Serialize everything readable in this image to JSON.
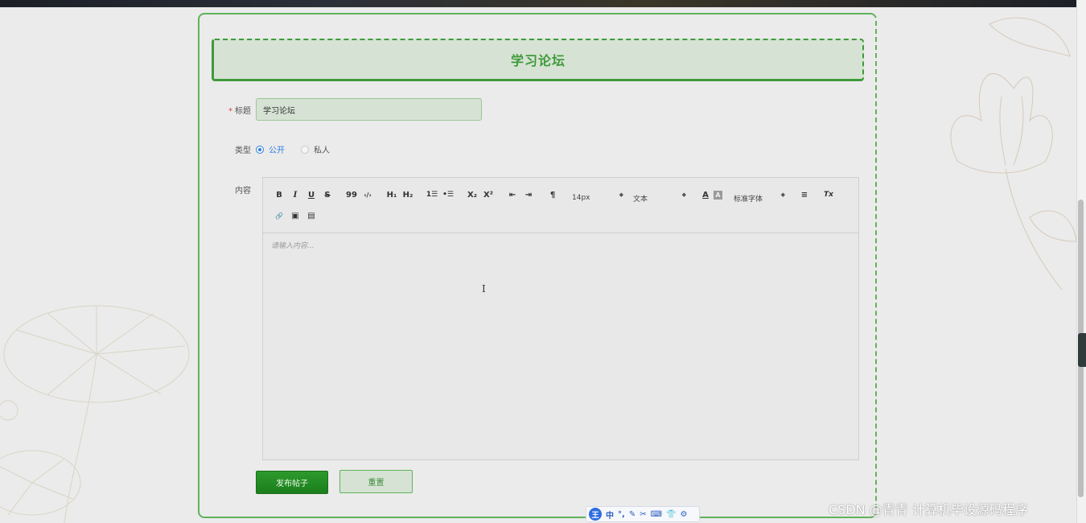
{
  "form": {
    "heading": "学习论坛",
    "title_label": "标题",
    "title_value": "学习论坛",
    "type_label": "类型",
    "type_options": [
      "公开",
      "私人"
    ],
    "type_selected": "公开",
    "content_label": "内容",
    "content_placeholder": "请输入内容...",
    "submit_label": "发布帖子",
    "reset_label": "重置"
  },
  "toolbar": {
    "bold": "B",
    "italic": "I",
    "underline": "U",
    "strike": "S",
    "blockquote": "99",
    "code": "‹/›",
    "h1": "H₁",
    "h2": "H₂",
    "ordered_list": "1☰",
    "bullet_list": "•☰",
    "subscript": "X₂",
    "superscript": "X²",
    "outdent": "⇤",
    "indent": "⇥",
    "direction": "¶",
    "size_select": "14px",
    "header_select": "文本",
    "color": "A",
    "background": "A",
    "font_select": "标准字体",
    "align": "≡",
    "clean": "Tx",
    "link": "🔗",
    "image": "▣",
    "video": "▤"
  },
  "ime": {
    "logo": "王",
    "mode": "中",
    "icons": [
      "°,",
      "✎",
      "✂",
      "⌨",
      "👕",
      "⚙"
    ]
  },
  "watermark": "CSDN @青青  计算机毕设源码程序"
}
